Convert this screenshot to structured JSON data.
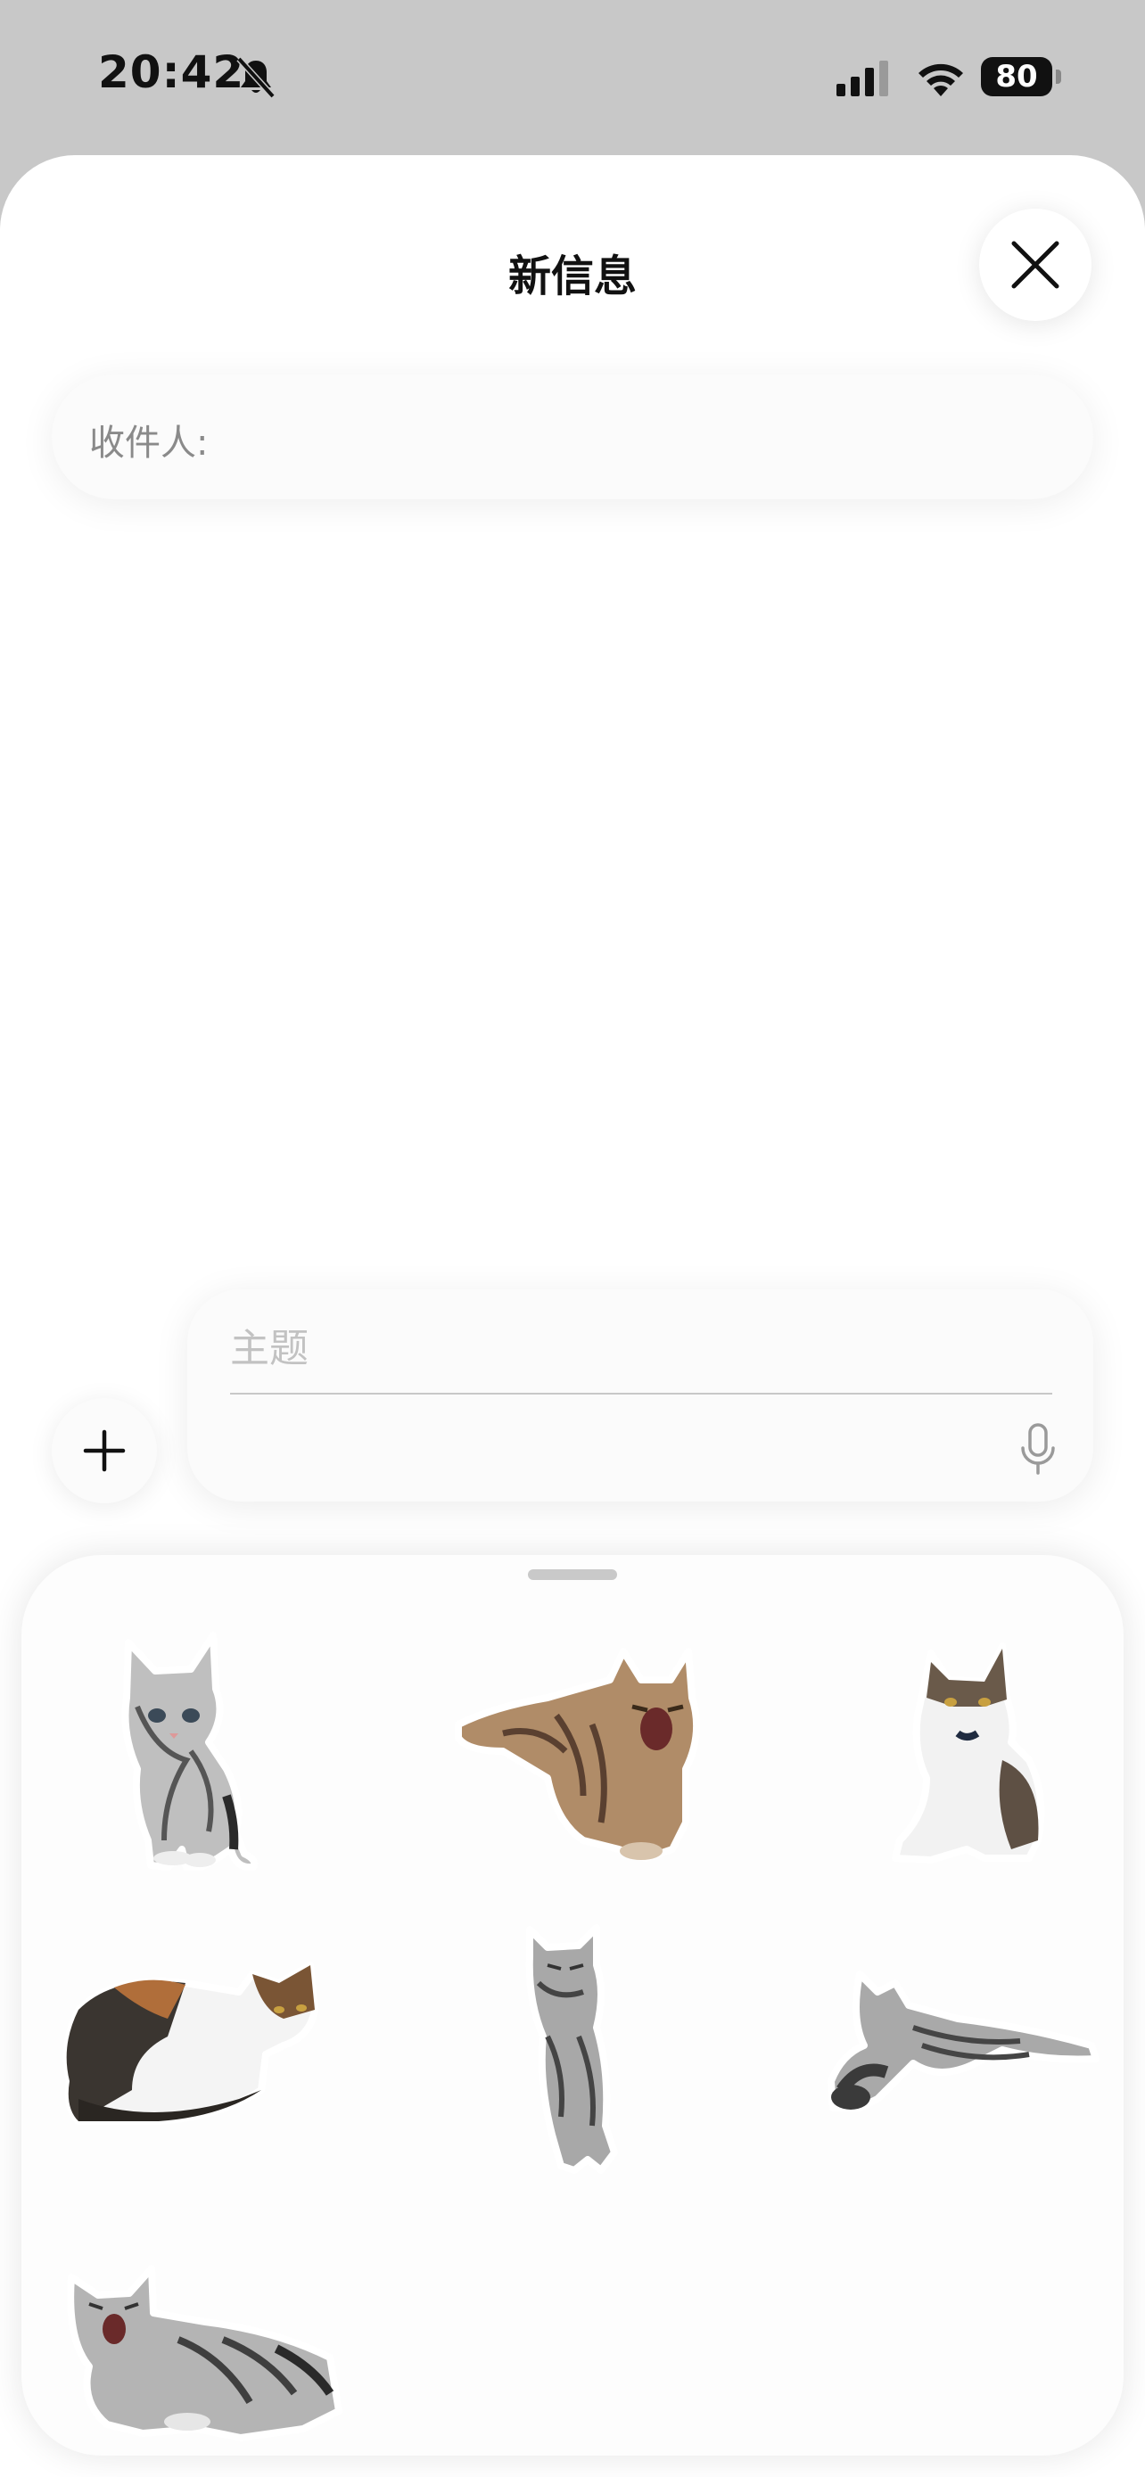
{
  "status_bar": {
    "time": "20:42",
    "silent_icon": "bell-slash-icon",
    "signal_icon": "cellular-signal-icon",
    "wifi_icon": "wifi-icon",
    "battery_level": "80"
  },
  "compose_sheet": {
    "title": "新信息",
    "close_icon": "xmark-icon",
    "recipient_label": "收件人:",
    "subject_placeholder": "主题",
    "add_icon": "plus-icon",
    "mic_icon": "microphone-icon"
  },
  "sticker_drawer": {
    "stickers": [
      {
        "name": "silver-tabby-kitten-standing"
      },
      {
        "name": "brown-tabby-cat-yawning-lying"
      },
      {
        "name": "calico-cat-sitting"
      },
      {
        "name": "calico-cat-lying"
      },
      {
        "name": "silver-tabby-cat-standing-tall"
      },
      {
        "name": "silver-tabby-cat-stretched-out"
      },
      {
        "name": "silver-tabby-cat-yawning-lying"
      }
    ]
  }
}
